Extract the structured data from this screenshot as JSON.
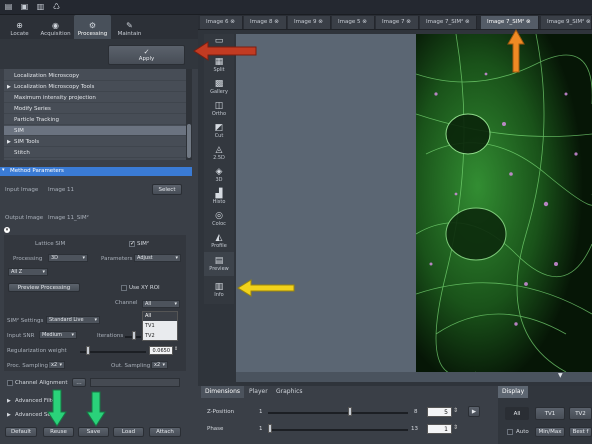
{
  "toolbar": {
    "icons": [
      "open-icon",
      "save-icon",
      "save-as-icon",
      "recycle-icon"
    ]
  },
  "left_tabs": [
    {
      "label": "Locate",
      "icon": "locate-icon"
    },
    {
      "label": "Acquisition",
      "icon": "acquisition-icon"
    },
    {
      "label": "Processing",
      "icon": "processing-gear-icon",
      "active": true
    },
    {
      "label": "Maintain",
      "icon": "maintain-wrench-icon"
    }
  ],
  "apply_button": "Apply",
  "method_list": [
    {
      "label": "Localization Microscopy",
      "expand": false
    },
    {
      "label": "Localization Microscopy Tools",
      "expand": true
    },
    {
      "label": "Maximum intensity projection",
      "expand": false
    },
    {
      "label": "Modify Series",
      "expand": false
    },
    {
      "label": "Particle Tracking",
      "expand": false
    },
    {
      "label": "SIM",
      "expand": false,
      "selected": true
    },
    {
      "label": "SIM Tools",
      "expand": true
    },
    {
      "label": "Stitch",
      "expand": false
    }
  ],
  "method_parameters": {
    "header": "Method Parameters",
    "input_image_label": "Input Image",
    "input_image_value": "Image 11",
    "select_button": "Select",
    "output_image_label": "Output Image",
    "output_image_value": "Image 11_SIM²"
  },
  "sim_params": {
    "lattice_label": "Lattice SIM",
    "sim2_label": "SIM²",
    "sim2_checked": true,
    "processing_label": "Processing",
    "processing_value": "3D",
    "parameters_label": "Parameters",
    "parameters_value": "Adjust",
    "z_value": "All Z",
    "preview_button": "Preview Processing",
    "use_xy_roi": "Use XY ROI",
    "channel_label": "Channel",
    "channel_value": "All",
    "channel_options": [
      "All",
      "TV1",
      "TV2"
    ],
    "sim2_settings_label": "SIM² Settings",
    "sim2_settings_value": "Standard Live",
    "input_snr_label": "Input SNR",
    "input_snr_value": "Medium",
    "iterations_label": "Iterations",
    "reg_weight_label": "Regularization weight",
    "reg_weight_value": "0.0650",
    "proc_sampling_label": "Proc. Sampling",
    "proc_sampling_value": "x2",
    "out_sampling_label": "Out. Sampling",
    "out_sampling_value": "x2"
  },
  "sections": [
    "Channel Alignment",
    "Advanced Filter",
    "Advanced Set"
  ],
  "bottom_buttons": [
    "Default",
    "Reuse",
    "Save",
    "Load",
    "Attach"
  ],
  "image_tabs": [
    {
      "label": "Image 6"
    },
    {
      "label": "Image 8"
    },
    {
      "label": "Image 9"
    },
    {
      "label": "Image 5"
    },
    {
      "label": "Image 7"
    },
    {
      "label": "Image 7_SIM²"
    },
    {
      "label": "Image 7_SIM²",
      "active": true
    },
    {
      "label": "Image 9_SIM²"
    }
  ],
  "view_tools": [
    {
      "label": "",
      "icon": "image-view-icon"
    },
    {
      "label": "Split",
      "icon": "split-icon"
    },
    {
      "label": "Gallery",
      "icon": "gallery-icon"
    },
    {
      "label": "Ortho",
      "icon": "ortho-icon"
    },
    {
      "label": "Cut",
      "icon": "cut-icon"
    },
    {
      "label": "2.5D",
      "icon": "2-5d-icon"
    },
    {
      "label": "3D",
      "icon": "3d-icon"
    },
    {
      "label": "Histo",
      "icon": "histo-icon"
    },
    {
      "label": "Coloc",
      "icon": "coloc-icon"
    },
    {
      "label": "Profile",
      "icon": "profile-icon"
    },
    {
      "label": "Preview",
      "icon": "preview-icon"
    },
    {
      "label": "Info",
      "icon": "info-icon"
    }
  ],
  "bottom_tabs": [
    "Dimensions",
    "Player",
    "Graphics"
  ],
  "display_tab": "Display",
  "dimensions": {
    "z_label": "Z-Position",
    "z_min": "1",
    "z_max": "8",
    "z_value": "5",
    "z_fraction": 0.57,
    "phase_label": "Phase",
    "phase_min": "1",
    "phase_max": "13",
    "phase_value": "1",
    "phase_fraction": 0.0
  },
  "display": {
    "channel_buttons": [
      "All",
      "TV1",
      "TV2"
    ],
    "auto_label": "Auto",
    "minmax_label": "Min/Max",
    "best_label": "Best f"
  },
  "colors": {
    "arrow_red": "#c23b22",
    "arrow_orange": "#f08a24",
    "arrow_yellow": "#f2d21b",
    "arrow_green": "#2ad27a",
    "accent_blue": "#3a7bd5"
  }
}
